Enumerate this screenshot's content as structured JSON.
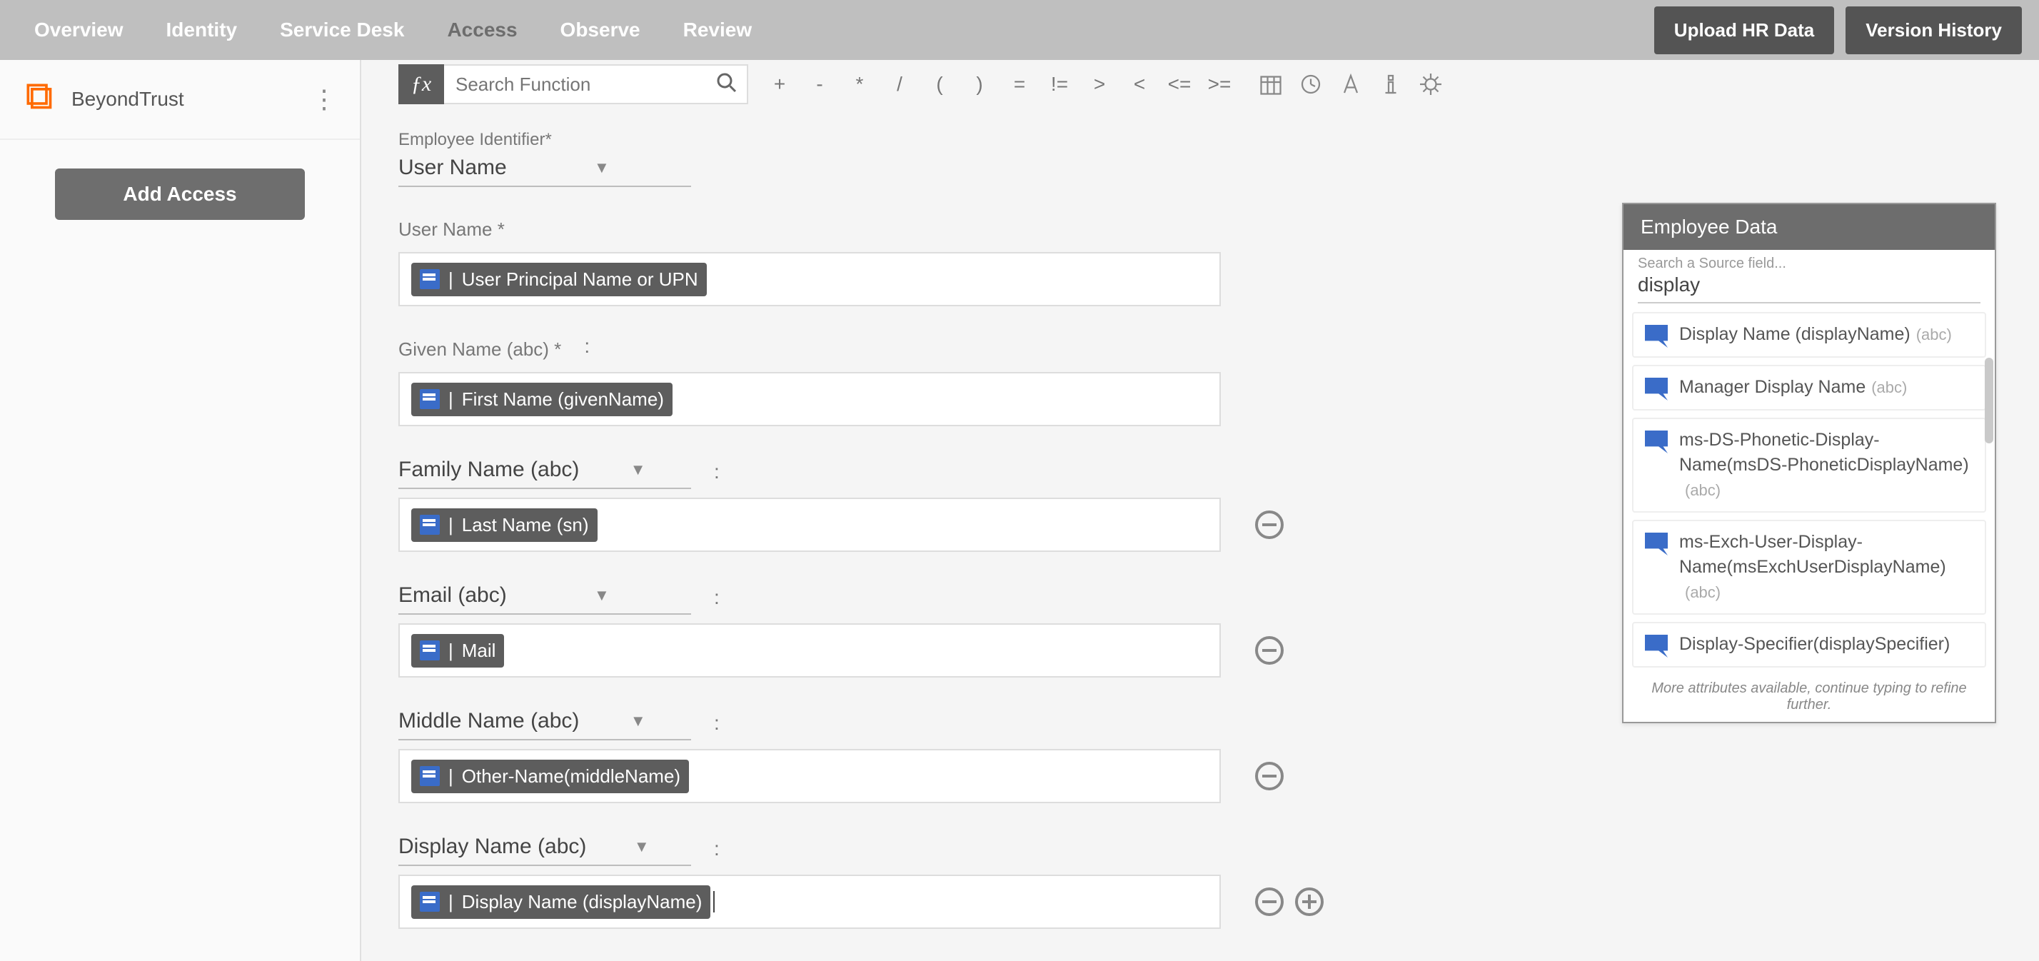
{
  "nav": {
    "items": [
      "Overview",
      "Identity",
      "Service Desk",
      "Access",
      "Observe",
      "Review"
    ],
    "active_index": 3,
    "upload_btn": "Upload HR Data",
    "version_btn": "Version History"
  },
  "sidebar": {
    "app_name": "BeyondTrust",
    "add_access_btn": "Add Access"
  },
  "formula_bar": {
    "search_placeholder": "Search Function",
    "operators": [
      "+",
      "-",
      "*",
      "/",
      "(",
      ")",
      "=",
      "!=",
      ">",
      "<",
      "<=",
      ">="
    ]
  },
  "employee_identifier": {
    "label": "Employee Identifier*",
    "value": "User Name"
  },
  "fields": [
    {
      "label": "User Name *",
      "select": null,
      "chip": "User Principal Name or UPN",
      "has_remove": false,
      "has_add": false
    },
    {
      "label": "Given Name (abc) *",
      "select": null,
      "chip": "First Name (givenName)",
      "colon": true,
      "has_remove": false,
      "has_add": false
    },
    {
      "label": null,
      "select": "Family Name (abc)",
      "chip": "Last Name (sn)",
      "colon": true,
      "has_remove": true,
      "has_add": false
    },
    {
      "label": null,
      "select": "Email (abc)",
      "chip": "Mail",
      "colon": true,
      "has_remove": true,
      "has_add": false
    },
    {
      "label": null,
      "select": "Middle Name (abc)",
      "chip": "Other-Name(middleName)",
      "colon": true,
      "has_remove": true,
      "has_add": false
    },
    {
      "label": null,
      "select": "Display Name (abc)",
      "chip": "Display Name (displayName)",
      "colon": true,
      "has_remove": true,
      "has_add": true,
      "cursor": true
    }
  ],
  "right_panel": {
    "title": "Employee Data",
    "search_label": "Search a Source field...",
    "search_value": "display",
    "results": [
      {
        "name": "Display Name (displayName)",
        "type": "(abc)"
      },
      {
        "name": "Manager Display Name",
        "type": "(abc)"
      },
      {
        "name": "ms-DS-Phonetic-Display-Name(msDS-PhoneticDisplayName)",
        "type": "(abc)"
      },
      {
        "name": "ms-Exch-User-Display-Name(msExchUserDisplayName)",
        "type": "(abc)"
      },
      {
        "name": "Display-Specifier(displaySpecifier)",
        "type": ""
      }
    ],
    "footer": "More attributes available, continue typing to refine further."
  }
}
